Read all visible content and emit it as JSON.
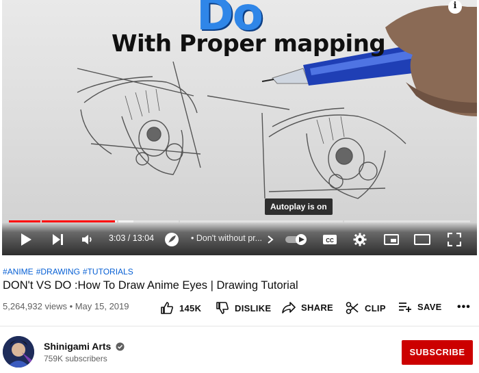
{
  "player": {
    "overlay_title_top": "Do",
    "overlay_title_bottom": "With Proper mapping",
    "info_icon": "info-icon",
    "autoplay_tooltip": "Autoplay is on",
    "progress": {
      "played_fraction": 0.23,
      "buffered_fraction": 0.27
    },
    "time_display": "3:03 / 13:04",
    "chapter_label": "• Don't without pr...",
    "controls": {
      "play": "play-icon",
      "next": "next-icon",
      "volume": "volume-icon",
      "autoplay": "autoplay-toggle-icon",
      "captions": "CC",
      "settings": "gear-icon",
      "miniplayer": "miniplayer-icon",
      "theater": "theater-icon",
      "fullscreen": "fullscreen-icon"
    }
  },
  "video": {
    "hashtags": [
      "#ANIME",
      "#DRAWING",
      "#TUTORIALS"
    ],
    "title": "DON't VS DO :How To Draw Anime Eyes | Drawing Tutorial",
    "views_date": "5,264,932 views • May 15, 2019"
  },
  "actions": {
    "like": "145K",
    "dislike": "DISLIKE",
    "share": "SHARE",
    "clip": "CLIP",
    "save": "SAVE",
    "more": "•••"
  },
  "channel": {
    "name": "Shinigami Arts",
    "subscribers": "759K subscribers",
    "subscribe_label": "SUBSCRIBE"
  },
  "colors": {
    "accent_red": "#cc0000",
    "progress_red": "#ff0000",
    "link_blue": "#065fd4"
  }
}
